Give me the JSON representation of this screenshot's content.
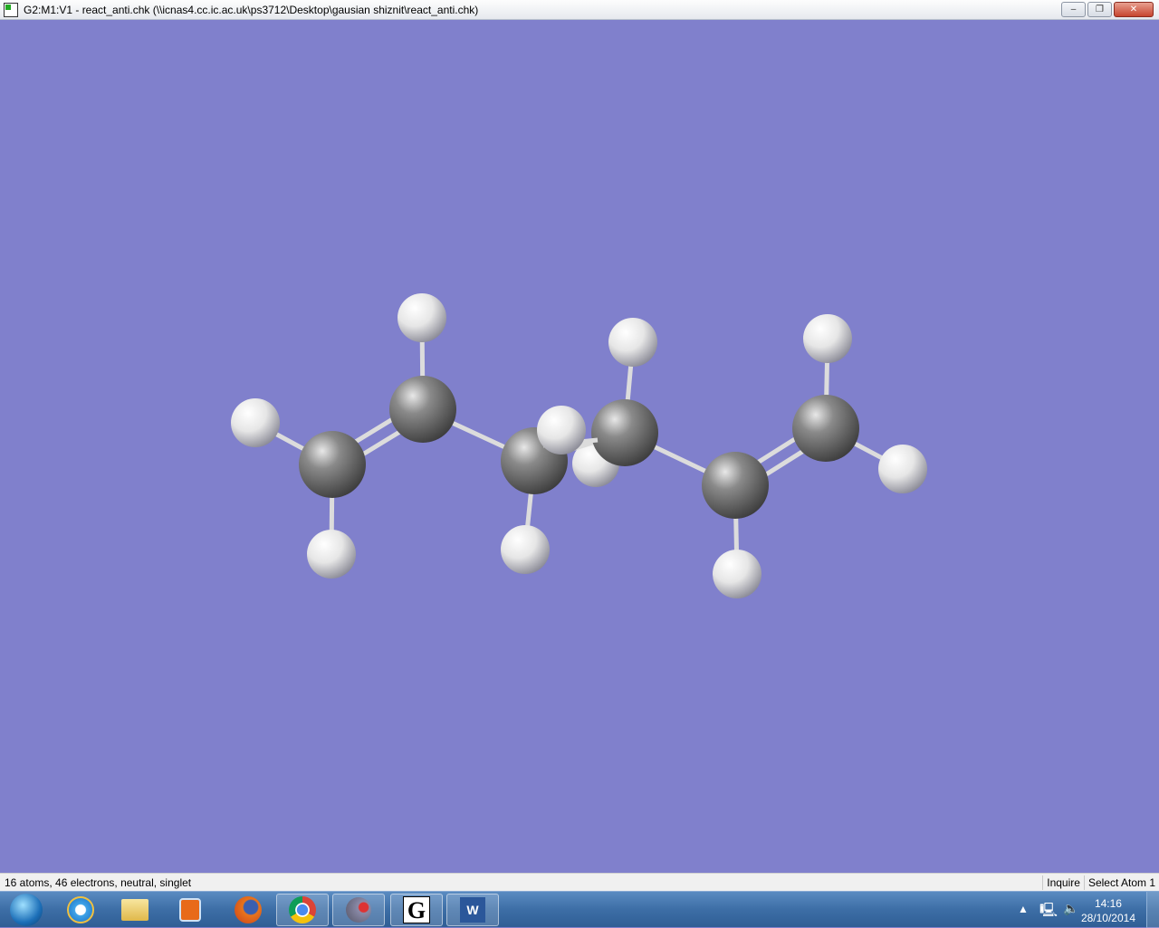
{
  "window": {
    "title": "G2:M1:V1 - react_anti.chk (\\\\icnas4.cc.ic.ac.uk\\ps3712\\Desktop\\gausian shiznit\\react_anti.chk)",
    "minimize": "‒",
    "restore": "❐",
    "close": "✕"
  },
  "status": {
    "info": "16 atoms, 46 electrons, neutral, singlet",
    "mode": "Inquire",
    "select": "Select Atom 1"
  },
  "taskbar": {
    "items": [
      "start",
      "internet-explorer",
      "file-explorer",
      "media-player",
      "firefox",
      "chrome",
      "gaussview",
      "gaussian",
      "word"
    ],
    "word_letter": "W",
    "gaussian_letter": "G"
  },
  "clock": {
    "time": "14:16",
    "date": "28/10/2014"
  },
  "colors": {
    "background": "#8080cc",
    "carbon": "#7a7a7a",
    "hydrogen": "#f0f0f0"
  },
  "molecule": {
    "name": "react_anti",
    "atom_count": 16
  }
}
